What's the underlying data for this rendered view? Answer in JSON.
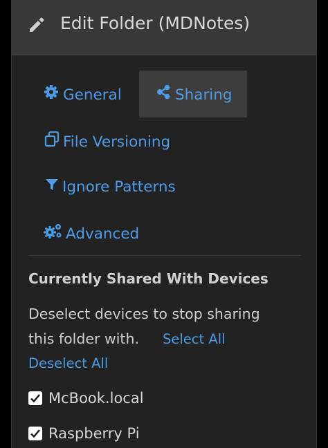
{
  "header": {
    "title": "Edit Folder (MDNotes)",
    "icon": "pencil-icon"
  },
  "tabs": [
    {
      "label": "General",
      "icon": "gear-icon",
      "active": false
    },
    {
      "label": "Sharing",
      "icon": "share-icon",
      "active": true
    },
    {
      "label": "File Versioning",
      "icon": "copy-icon",
      "active": false
    },
    {
      "label": "Ignore Patterns",
      "icon": "filter-icon",
      "active": false
    },
    {
      "label": "Advanced",
      "icon": "gears-icon",
      "active": false
    }
  ],
  "sharing": {
    "section_title": "Currently Shared With Devices",
    "help_line1": "Deselect devices to stop sharing",
    "help_line2": "this folder with.",
    "select_all": "Select All",
    "deselect_all": "Deselect All",
    "devices": [
      {
        "name": "McBook.local",
        "checked": true
      },
      {
        "name": "Raspberry Pi",
        "checked": true
      }
    ]
  },
  "colors": {
    "link": "#4d9be6",
    "panel_bg": "#222222",
    "header_bg": "#383838",
    "active_tab_bg": "#3d3d3d"
  }
}
